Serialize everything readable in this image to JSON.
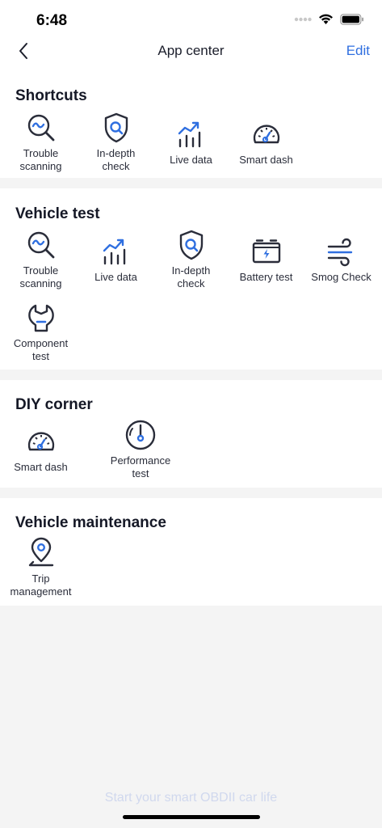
{
  "status": {
    "time": "6:48"
  },
  "nav": {
    "title": "App center",
    "edit_label": "Edit"
  },
  "sections": [
    {
      "title": "Shortcuts",
      "items": [
        {
          "label": "Trouble\nscanning",
          "icon": "trouble-scan-icon"
        },
        {
          "label": "In-depth\ncheck",
          "icon": "shield-search-icon"
        },
        {
          "label": "Live data",
          "icon": "live-data-icon"
        },
        {
          "label": "Smart dash",
          "icon": "gauge-icon"
        }
      ]
    },
    {
      "title": "Vehicle test",
      "items": [
        {
          "label": "Trouble\nscanning",
          "icon": "trouble-scan-icon"
        },
        {
          "label": "Live data",
          "icon": "live-data-icon"
        },
        {
          "label": "In-depth\ncheck",
          "icon": "shield-search-icon"
        },
        {
          "label": "Battery test",
          "icon": "battery-icon"
        },
        {
          "label": "Smog Check",
          "icon": "wind-icon"
        },
        {
          "label": "Component\ntest",
          "icon": "wrench-icon"
        }
      ]
    },
    {
      "title": "DIY corner",
      "items": [
        {
          "label": "Smart dash",
          "icon": "gauge-icon"
        },
        {
          "label": "Performance\ntest",
          "icon": "performance-gauge-icon"
        }
      ]
    },
    {
      "title": "Vehicle maintenance",
      "items": [
        {
          "label": "Trip\nmanagement",
          "icon": "location-pin-icon"
        }
      ]
    }
  ],
  "footer": {
    "text": "Start your smart OBDII car life"
  },
  "colors": {
    "accent": "#2f6fe0",
    "icon_dark": "#2a2d3a",
    "background": "#f4f4f4"
  }
}
